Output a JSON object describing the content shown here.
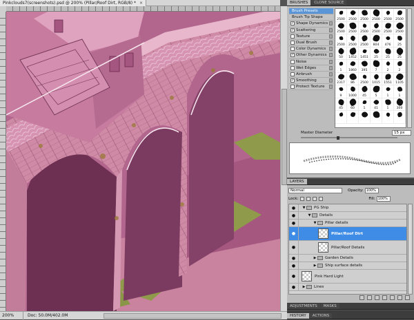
{
  "document": {
    "tab_title": "Pinkclouds7(screenshots).psd @ 200% (Pillar/Roof Dirt, RGB/8) *",
    "close_glyph": "×",
    "zoom": "200%",
    "doc_size": "Doc: 50.0M/402.0M"
  },
  "brushes_panel": {
    "tabs": [
      "BRUSHES",
      "CLONE SOURCE"
    ],
    "options": [
      {
        "label": "Brush Presets",
        "checkbox": false,
        "checked": false,
        "selected": true
      },
      {
        "label": "Brush Tip Shape",
        "checkbox": false,
        "checked": false,
        "selected": false
      },
      {
        "label": "Shape Dynamics",
        "checkbox": true,
        "checked": true,
        "selected": false
      },
      {
        "label": "Scattering",
        "checkbox": true,
        "checked": true,
        "selected": false
      },
      {
        "label": "Texture",
        "checkbox": true,
        "checked": false,
        "selected": false
      },
      {
        "label": "Dual Brush",
        "checkbox": true,
        "checked": false,
        "selected": false
      },
      {
        "label": "Color Dynamics",
        "checkbox": true,
        "checked": false,
        "selected": false
      },
      {
        "label": "Other Dynamics",
        "checkbox": true,
        "checked": true,
        "selected": false
      },
      {
        "label": "Noise",
        "checkbox": true,
        "checked": false,
        "selected": false
      },
      {
        "label": "Wet Edges",
        "checkbox": true,
        "checked": false,
        "selected": false
      },
      {
        "label": "Airbrush",
        "checkbox": true,
        "checked": false,
        "selected": false
      },
      {
        "label": "Smoothing",
        "checkbox": true,
        "checked": true,
        "selected": false
      },
      {
        "label": "Protect Texture",
        "checkbox": true,
        "checked": false,
        "selected": false
      }
    ],
    "presets": [
      "2500",
      "2500",
      "2500",
      "2500",
      "2500",
      "2500",
      "2500",
      "2500",
      "2500",
      "2500",
      "2500",
      "2500",
      "2500",
      "2500",
      "2500",
      "804",
      "476",
      "25",
      "50",
      "1452",
      "1451",
      "25",
      "25",
      "25",
      "1",
      "1860",
      "395",
      "7",
      "2",
      "2",
      "2317",
      "86",
      "2500",
      "1015",
      "1551",
      "1105",
      "9",
      "1000",
      "45",
      "5",
      "1",
      "1",
      "45",
      "60",
      "1",
      "41",
      "1",
      "300",
      "",
      "",
      "",
      "",
      "",
      ""
    ],
    "master_diameter_label": "Master Diameter",
    "master_diameter_value": "15 px"
  },
  "layers_panel": {
    "tabs": [
      "LAYERS"
    ],
    "blend_mode": "Normal",
    "opacity_label": "Opacity:",
    "opacity_value": "100%",
    "lock_label": "Lock:",
    "fill_label": "Fill:",
    "fill_value": "100%",
    "eye_glyph": "●",
    "layers": [
      {
        "name": "PG Ship",
        "type": "group",
        "indent": 0,
        "eye": true,
        "selected": false
      },
      {
        "name": "Details",
        "type": "group",
        "indent": 1,
        "eye": true,
        "selected": false
      },
      {
        "name": "Pillar details",
        "type": "group",
        "indent": 2,
        "eye": true,
        "selected": false
      },
      {
        "name": "Pillar/Roof Dirt",
        "type": "layer",
        "indent": 3,
        "eye": true,
        "selected": true
      },
      {
        "name": "Pillar/Roof Details",
        "type": "layer",
        "indent": 3,
        "eye": true,
        "selected": false
      },
      {
        "name": "Garden Details",
        "type": "group",
        "indent": 2,
        "eye": true,
        "selected": false
      },
      {
        "name": "Ship surface details",
        "type": "group",
        "indent": 2,
        "eye": true,
        "selected": false
      },
      {
        "name": "Pink Hard Light",
        "type": "layer",
        "indent": 0,
        "eye": true,
        "selected": false
      },
      {
        "name": "Lines",
        "type": "group",
        "indent": 0,
        "eye": true,
        "selected": false
      }
    ]
  },
  "bottom_tabs": {
    "adjustments": [
      "ADJUSTMENTS",
      "MASKS"
    ],
    "history": [
      "HISTORY",
      "ACTIONS"
    ]
  },
  "colors": {
    "selection": "#3e8ce6",
    "canvas_pink": "#c57aa0",
    "grass": "#8f9a4a"
  }
}
